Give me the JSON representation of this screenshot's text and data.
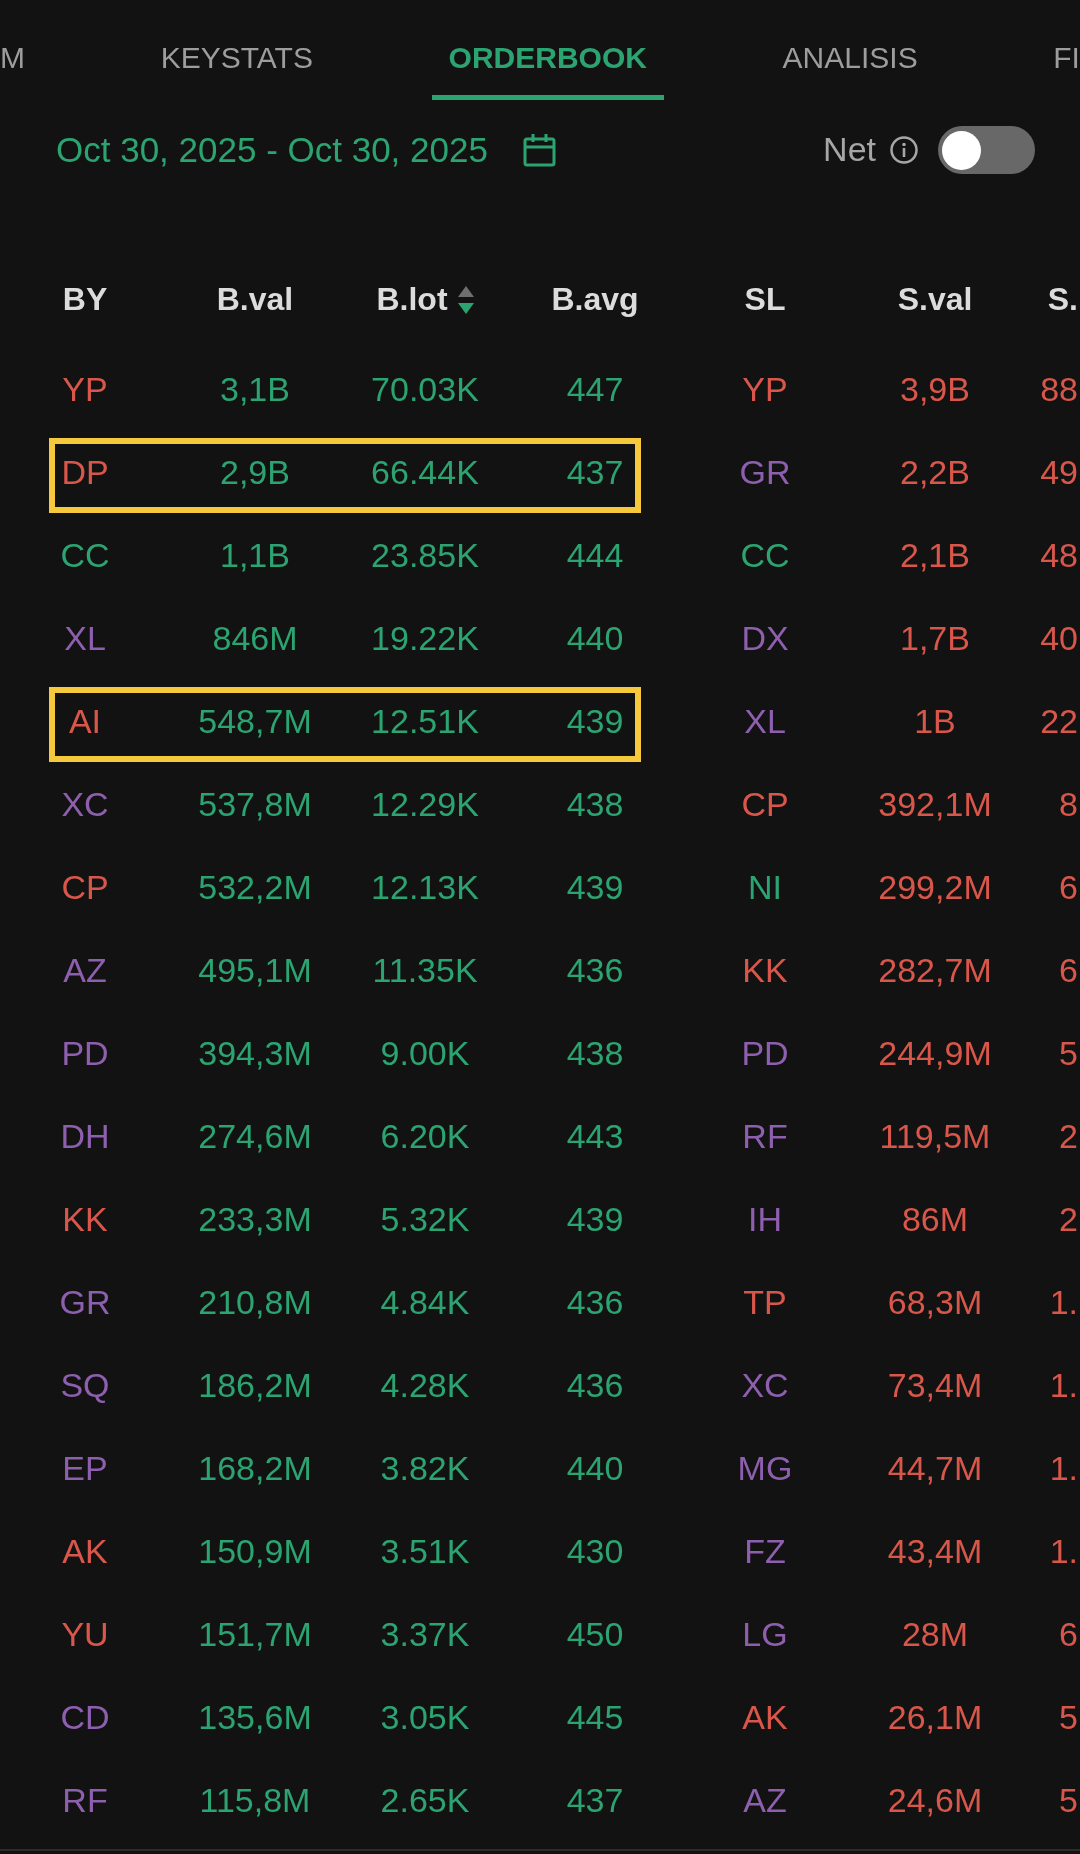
{
  "tabs": [
    {
      "label": "M",
      "selected": false
    },
    {
      "label": "KEYSTATS",
      "selected": false
    },
    {
      "label": "ORDERBOOK",
      "selected": true
    },
    {
      "label": "ANALISIS",
      "selected": false
    },
    {
      "label": "FI",
      "selected": false
    }
  ],
  "date_range": {
    "text": "Oct 30, 2025 - Oct 30, 2025"
  },
  "net_toggle": {
    "label": "Net",
    "on": false
  },
  "table": {
    "columns": [
      {
        "label": "BY"
      },
      {
        "label": "B.val"
      },
      {
        "label": "B.lot",
        "sort_descending": true
      },
      {
        "label": "B.avg"
      },
      {
        "label": "SL"
      },
      {
        "label": "S.val"
      },
      {
        "label": "S."
      }
    ],
    "rows": [
      {
        "buyer": {
          "code": "YP",
          "color": "#d9574a"
        },
        "b_val": "3,1B",
        "b_lot": "70.03K",
        "b_avg": "447",
        "seller": {
          "code": "YP",
          "color": "#d9574a"
        },
        "s_val": "3,9B",
        "column_7": "88",
        "highlighted": false
      },
      {
        "buyer": {
          "code": "DP",
          "color": "#d9574a"
        },
        "b_val": "2,9B",
        "b_lot": "66.44K",
        "b_avg": "437",
        "seller": {
          "code": "GR",
          "color": "#8d5fae"
        },
        "s_val": "2,2B",
        "column_7": "49",
        "highlighted": true
      },
      {
        "buyer": {
          "code": "CC",
          "color": "#2ca471"
        },
        "b_val": "1,1B",
        "b_lot": "23.85K",
        "b_avg": "444",
        "seller": {
          "code": "CC",
          "color": "#2ca471"
        },
        "s_val": "2,1B",
        "column_7": "48",
        "highlighted": false
      },
      {
        "buyer": {
          "code": "XL",
          "color": "#8d5fae"
        },
        "b_val": "846M",
        "b_lot": "19.22K",
        "b_avg": "440",
        "seller": {
          "code": "DX",
          "color": "#8d5fae"
        },
        "s_val": "1,7B",
        "column_7": "40",
        "highlighted": false
      },
      {
        "buyer": {
          "code": "AI",
          "color": "#d9574a"
        },
        "b_val": "548,7M",
        "b_lot": "12.51K",
        "b_avg": "439",
        "seller": {
          "code": "XL",
          "color": "#8d5fae"
        },
        "s_val": "1B",
        "column_7": "22",
        "highlighted": true
      },
      {
        "buyer": {
          "code": "XC",
          "color": "#8d5fae"
        },
        "b_val": "537,8M",
        "b_lot": "12.29K",
        "b_avg": "438",
        "seller": {
          "code": "CP",
          "color": "#d9574a"
        },
        "s_val": "392,1M",
        "column_7": "8",
        "highlighted": false
      },
      {
        "buyer": {
          "code": "CP",
          "color": "#d9574a"
        },
        "b_val": "532,2M",
        "b_lot": "12.13K",
        "b_avg": "439",
        "seller": {
          "code": "NI",
          "color": "#2ca471"
        },
        "s_val": "299,2M",
        "column_7": "6",
        "highlighted": false
      },
      {
        "buyer": {
          "code": "AZ",
          "color": "#8d5fae"
        },
        "b_val": "495,1M",
        "b_lot": "11.35K",
        "b_avg": "436",
        "seller": {
          "code": "KK",
          "color": "#d9574a"
        },
        "s_val": "282,7M",
        "column_7": "6",
        "highlighted": false
      },
      {
        "buyer": {
          "code": "PD",
          "color": "#8d5fae"
        },
        "b_val": "394,3M",
        "b_lot": "9.00K",
        "b_avg": "438",
        "seller": {
          "code": "PD",
          "color": "#8d5fae"
        },
        "s_val": "244,9M",
        "column_7": "5",
        "highlighted": false
      },
      {
        "buyer": {
          "code": "DH",
          "color": "#8d5fae"
        },
        "b_val": "274,6M",
        "b_lot": "6.20K",
        "b_avg": "443",
        "seller": {
          "code": "RF",
          "color": "#8d5fae"
        },
        "s_val": "119,5M",
        "column_7": "2",
        "highlighted": false
      },
      {
        "buyer": {
          "code": "KK",
          "color": "#d9574a"
        },
        "b_val": "233,3M",
        "b_lot": "5.32K",
        "b_avg": "439",
        "seller": {
          "code": "IH",
          "color": "#8d5fae"
        },
        "s_val": "86M",
        "column_7": "2",
        "highlighted": false
      },
      {
        "buyer": {
          "code": "GR",
          "color": "#8d5fae"
        },
        "b_val": "210,8M",
        "b_lot": "4.84K",
        "b_avg": "436",
        "seller": {
          "code": "TP",
          "color": "#d9574a"
        },
        "s_val": "68,3M",
        "column_7": "1.",
        "highlighted": false
      },
      {
        "buyer": {
          "code": "SQ",
          "color": "#8d5fae"
        },
        "b_val": "186,2M",
        "b_lot": "4.28K",
        "b_avg": "436",
        "seller": {
          "code": "XC",
          "color": "#8d5fae"
        },
        "s_val": "73,4M",
        "column_7": "1.",
        "highlighted": false
      },
      {
        "buyer": {
          "code": "EP",
          "color": "#8d5fae"
        },
        "b_val": "168,2M",
        "b_lot": "3.82K",
        "b_avg": "440",
        "seller": {
          "code": "MG",
          "color": "#8d5fae"
        },
        "s_val": "44,7M",
        "column_7": "1.",
        "highlighted": false
      },
      {
        "buyer": {
          "code": "AK",
          "color": "#d9574a"
        },
        "b_val": "150,9M",
        "b_lot": "3.51K",
        "b_avg": "430",
        "seller": {
          "code": "FZ",
          "color": "#8d5fae"
        },
        "s_val": "43,4M",
        "column_7": "1.",
        "highlighted": false
      },
      {
        "buyer": {
          "code": "YU",
          "color": "#d9574a"
        },
        "b_val": "151,7M",
        "b_lot": "3.37K",
        "b_avg": "450",
        "seller": {
          "code": "LG",
          "color": "#8d5fae"
        },
        "s_val": "28M",
        "column_7": "6",
        "highlighted": false
      },
      {
        "buyer": {
          "code": "CD",
          "color": "#8d5fae"
        },
        "b_val": "135,6M",
        "b_lot": "3.05K",
        "b_avg": "445",
        "seller": {
          "code": "AK",
          "color": "#d9574a"
        },
        "s_val": "26,1M",
        "column_7": "5",
        "highlighted": false
      },
      {
        "buyer": {
          "code": "RF",
          "color": "#8d5fae"
        },
        "b_val": "115,8M",
        "b_lot": "2.65K",
        "b_avg": "437",
        "seller": {
          "code": "AZ",
          "color": "#8d5fae"
        },
        "s_val": "24,6M",
        "column_7": "5",
        "highlighted": false
      }
    ]
  }
}
